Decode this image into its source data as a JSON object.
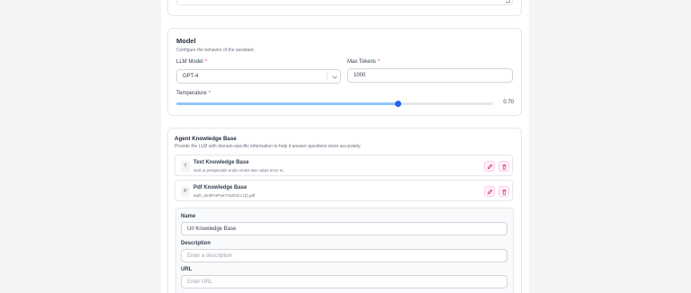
{
  "model": {
    "title": "Model",
    "subtitle": "Configure the behavior of the assistant.",
    "llm_label": "LLM Model",
    "llm_value": "GPT-4",
    "max_tokens_label": "Max Tokens",
    "max_tokens_value": "1000",
    "temperature_label": "Temperature",
    "temperature_value": "0.70",
    "temperature_fraction": 0.7
  },
  "knowledge": {
    "title": "Agent Knowledge Base",
    "subtitle": "Provide the LLM with domain-specific information to help it answer questions more accurately.",
    "items": [
      {
        "letter": "T",
        "name": "Text Knowledge Base",
        "desc": "Sed ut perspiciatis unde omnis iste natus error si..."
      },
      {
        "letter": "P",
        "name": "Pdf Knowledge Base",
        "desc": "auth_3e4PmPVe7YaZCEJ (2).pdf"
      }
    ],
    "form": {
      "name_label": "Name",
      "name_value": "Url Knowledge Base",
      "description_label": "Description",
      "description_placeholder": "Enter a description",
      "url_label": "URL",
      "url_placeholder": "Enter URL"
    }
  },
  "colors": {
    "accent": "#2563eb",
    "slider_fill": "#93c5fd",
    "required": "#ef4444",
    "action_icon": "#db2777"
  },
  "icons": [
    "chevron-down-icon",
    "pencil-icon",
    "trash-icon"
  ]
}
